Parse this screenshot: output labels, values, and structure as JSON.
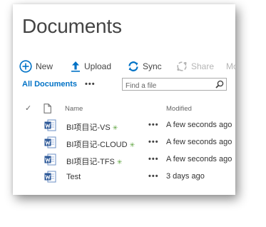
{
  "page": {
    "title": "Documents"
  },
  "toolbar": {
    "new_label": "New",
    "upload_label": "Upload",
    "sync_label": "Sync",
    "share_label": "Share",
    "more_label": "Mo",
    "icons": [
      "plus-circle-icon",
      "upload-arrow-icon",
      "sync-icon",
      "share-icon"
    ]
  },
  "view": {
    "current": "All Documents",
    "more_label": "•••",
    "search_placeholder": "Find a file",
    "search_icon": "search-icon"
  },
  "list": {
    "columns": {
      "select": "✓",
      "type_icon": "document-icon",
      "name": "Name",
      "modified": "Modified"
    },
    "new_mark": "✳",
    "more_label": "•••",
    "rows": [
      {
        "name": "BI项目记-VS",
        "is_new": true,
        "modified": "A few seconds ago",
        "type": "word"
      },
      {
        "name": "BI项目记-CLOUD",
        "is_new": true,
        "modified": "A few seconds ago",
        "type": "word"
      },
      {
        "name": "BI项目记-TFS",
        "is_new": true,
        "modified": "A few seconds ago",
        "type": "word"
      },
      {
        "name": "Test",
        "is_new": false,
        "modified": "3 days ago",
        "type": "word"
      }
    ]
  },
  "colors": {
    "accent": "#0072c6",
    "new_mark": "#5aa13a",
    "title": "#444444",
    "disabled": "#b5b5b5"
  }
}
